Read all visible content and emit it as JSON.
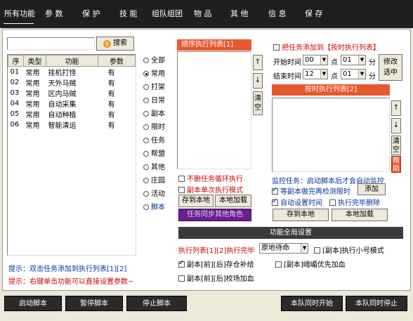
{
  "tabs": [
    "所有功能",
    "参 数",
    "保 护",
    "技 能",
    "组队组团",
    "物 品",
    "其 他",
    "信 息",
    "保 存"
  ],
  "search": {
    "value": "",
    "button": "搜索"
  },
  "func_table": {
    "headers": [
      "序",
      "类型",
      "功能",
      "参数"
    ],
    "rows": [
      [
        "01",
        "常用",
        "挂机打怪",
        "有"
      ],
      [
        "02",
        "常用",
        "天外马贼",
        "有"
      ],
      [
        "03",
        "常用",
        "区内马贼",
        "有"
      ],
      [
        "04",
        "常用",
        "自动采集",
        "有"
      ],
      [
        "05",
        "常用",
        "自动种植",
        "有"
      ],
      [
        "06",
        "常用",
        "智能清运",
        "有"
      ]
    ]
  },
  "categories": [
    "全部",
    "常用",
    "打架",
    "日常",
    "副本",
    "限时",
    "任务",
    "帮盟",
    "其他",
    "庄园",
    "活动",
    "脚本"
  ],
  "selected_category": "常用",
  "sequence": {
    "title": "顺序执行列表[1]",
    "up": "↑",
    "down": "↓",
    "clear": "清空",
    "no_delete": "不删任务循环执行",
    "single_mode": "副本单次执行模式",
    "save_local": "存到本地",
    "load_local": "本地加载",
    "sync": "任务同步其他角色"
  },
  "timed": {
    "add_label": "把任务添加到【按时执行列表】",
    "start_label": "开始时间",
    "start_hour": "00",
    "start_min": "01",
    "end_label": "结束时间",
    "end_hour": "12",
    "end_min": "01",
    "point": "点",
    "minute": "分",
    "modify": "修改\n选中",
    "title": "按时执行列表[2]",
    "up": "↑",
    "down": "↓",
    "clear": "清空",
    "help": "帮助",
    "monitor": "监控任务：启动脚本后才会自动监控",
    "wait_dungeon": "等副本做完再检测限时",
    "add_btn": "添加",
    "auto_time": "自动设置时间",
    "delete_done": "执行完毕删除",
    "save_local": "存到本地",
    "load_local": "本地加载"
  },
  "global": {
    "title": "功能全局设置",
    "exec_label": "执行列表[1][2]执行完毕",
    "exec_value": "原地待命",
    "small_mode": "[副本]执行小号模式",
    "store": "副本[前][后]存仓补给",
    "dungeon_priority": "[副本]峨嵋优先加血",
    "heal": "副本[前][后]校场加血"
  },
  "tips": {
    "tip1": "提示：双击任务添加到执行列表[1][2]",
    "tip2": "提示：右键单击功能可以直接设置参数~"
  },
  "bottom": {
    "start": "启动脚本",
    "pause": "暂停脚本",
    "stop": "停止脚本",
    "team_start": "本队同时开始",
    "team_stop": "本队同时停止"
  }
}
